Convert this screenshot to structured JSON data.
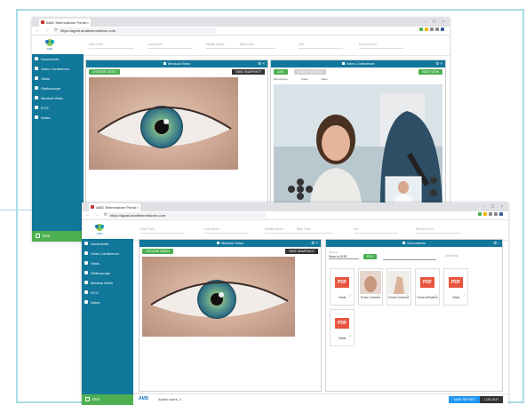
{
  "browser": {
    "tab_title": "AMD Telemedicine Portal",
    "url": "https://agnet.amdtelemedicine.com"
  },
  "header": {
    "logo_text": "AMD",
    "fields": [
      "Date Field",
      "Last Name",
      "Middle Name",
      "Birth Date",
      "Sex",
      "Record Num"
    ]
  },
  "sidebar": {
    "items": [
      "Documents",
      "Video Conference",
      "Vitals",
      "Stethoscope",
      "Medical Video",
      "ECG",
      "Notes"
    ],
    "end_label": "End"
  },
  "medical_video": {
    "title": "Medical Video",
    "choose_label": "CHOOSE VIDEO",
    "snapshot_label": "TAKE SNAPSHOT"
  },
  "video_conference": {
    "title": "Video Conference",
    "left_btn": "LIVE",
    "mid_btn": "SHARE SCREEN",
    "right_btn": "SELF VIEW",
    "toggles": [
      "Microphone",
      "Audio",
      "Video"
    ]
  },
  "documents": {
    "title": "Documents",
    "save_to": "Save to EHR",
    "save_label": "Save to",
    "file_btn": "FILE",
    "select_all": "Select All",
    "items": [
      {
        "label": "Vitals",
        "kind": "pdf"
      },
      {
        "label": "Exam Camera",
        "kind": "image"
      },
      {
        "label": "ExamCamera1",
        "kind": "image"
      },
      {
        "label": "GeneralPattern",
        "kind": "pdf"
      },
      {
        "label": "Vitals",
        "kind": "pdf"
      },
      {
        "label": "Vitals",
        "kind": "pdf"
      }
    ]
  },
  "footer": {
    "brand": "AMD",
    "status": "Active users: 2",
    "btn1": "SAVE REPORT",
    "btn2": "LOG OUT"
  },
  "colors": {
    "accent": "#11779b",
    "green": "#4caf50",
    "pdf": "#e8553e"
  }
}
